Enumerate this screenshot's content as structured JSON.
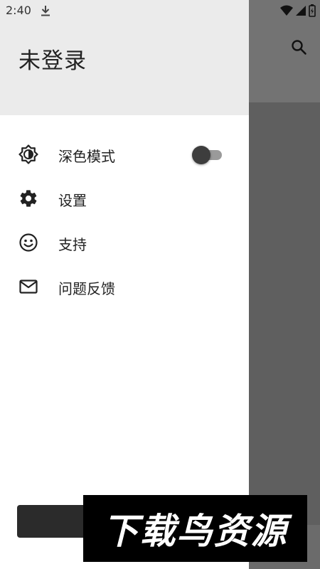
{
  "status_bar": {
    "time": "2:40",
    "icons": [
      "download-icon",
      "wifi-icon",
      "signal-icon",
      "battery-icon"
    ]
  },
  "app_bar": {
    "actions": [
      "search-icon"
    ]
  },
  "drawer": {
    "title": "未登录",
    "items": [
      {
        "label": "深色模式",
        "icon": "brightness-icon",
        "toggle": true,
        "toggle_on": false
      },
      {
        "label": "设置",
        "icon": "gear-icon"
      },
      {
        "label": "支持",
        "icon": "smile-icon"
      },
      {
        "label": "问题反馈",
        "icon": "mail-icon"
      }
    ]
  },
  "watermark": {
    "text": "下载鸟资源"
  },
  "colors": {
    "drawer_header": "#ebebeb",
    "scrim": "#5f5f5f",
    "text": "#222222"
  }
}
